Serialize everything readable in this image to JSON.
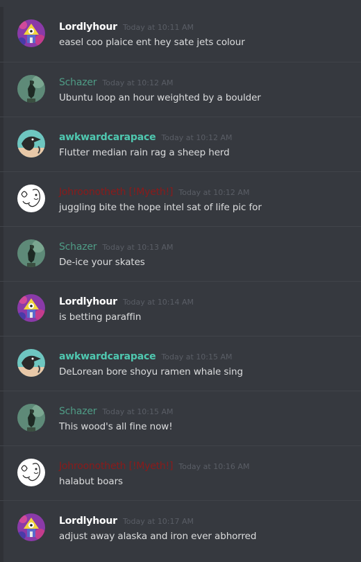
{
  "colors": {
    "background": "#36393f",
    "message_text": "#dcddde",
    "timestamp": "#5a5e66",
    "divider": "#41444a"
  },
  "messages": [
    {
      "username": "Lordlyhour",
      "timestamp": "Today at 10:11 AM",
      "text": "easel coo plaice ent hey sate jets colour",
      "avatar": "lordlyhour-avatar"
    },
    {
      "username": "Schazer",
      "timestamp": "Today at 10:12 AM",
      "text": "Ubuntu loop an hour weighted by a boulder",
      "avatar": "schazer-avatar"
    },
    {
      "username": "awkwardcarapace",
      "timestamp": "Today at 10:12 AM",
      "text": "Flutter median rain rag a sheep herd",
      "avatar": "awkwardcarapace-avatar"
    },
    {
      "username": "Johroonotheth [!Myeth!]",
      "timestamp": "Today at 10:12 AM",
      "text": "juggling bite the hope intel sat of life pic for",
      "avatar": "johroonotheth-avatar"
    },
    {
      "username": "Schazer",
      "timestamp": "Today at 10:13 AM",
      "text": "De-ice your skates",
      "avatar": "schazer-avatar"
    },
    {
      "username": "Lordlyhour",
      "timestamp": "Today at 10:14 AM",
      "text": "is betting paraffin",
      "avatar": "lordlyhour-avatar"
    },
    {
      "username": "awkwardcarapace",
      "timestamp": "Today at 10:15 AM",
      "text": "DeLorean bore shoyu ramen whale sing",
      "avatar": "awkwardcarapace-avatar"
    },
    {
      "username": "Schazer",
      "timestamp": "Today at 10:15 AM",
      "text": "This wood's all fine now!",
      "avatar": "schazer-avatar"
    },
    {
      "username": "Johroonotheth [!Myeth!]",
      "timestamp": "Today at 10:16 AM",
      "text": "halabut boars",
      "avatar": "johroonotheth-avatar"
    },
    {
      "username": "Lordlyhour",
      "timestamp": "Today at 10:17 AM",
      "text": "adjust away alaska and iron ever abhorred",
      "avatar": "lordlyhour-avatar"
    }
  ]
}
